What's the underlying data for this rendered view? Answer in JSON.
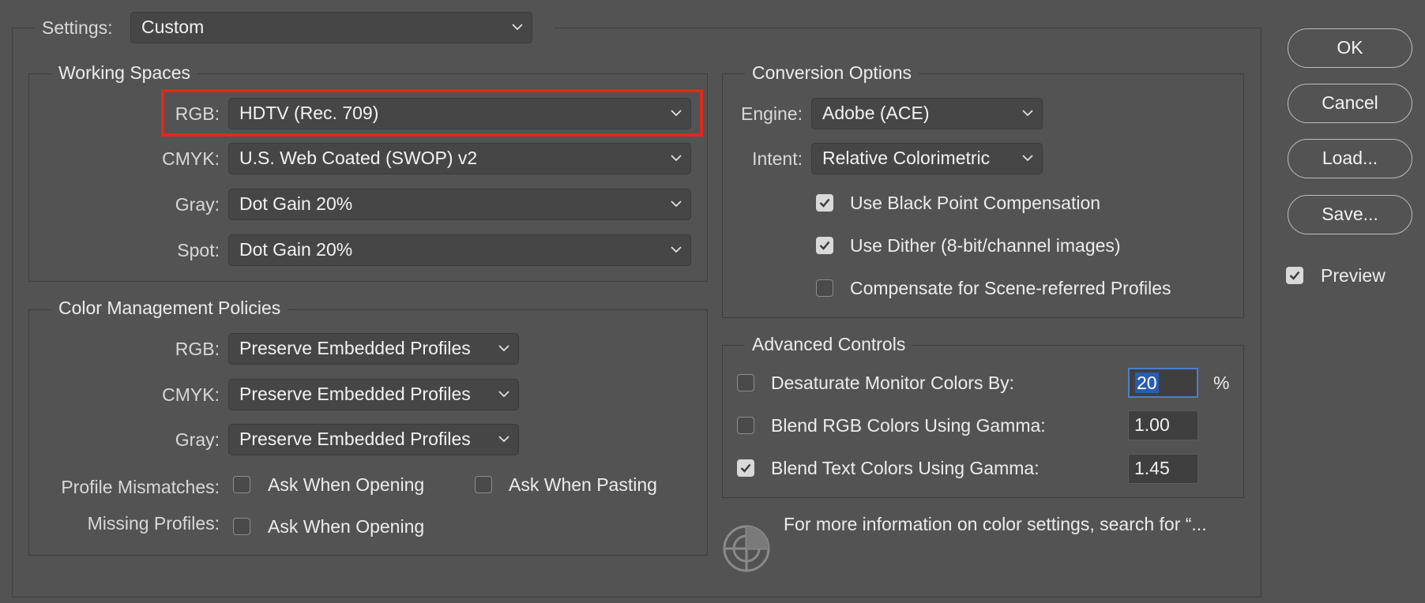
{
  "settings": {
    "label": "Settings:",
    "value": "Custom"
  },
  "working_spaces": {
    "title": "Working Spaces",
    "rgb": {
      "label": "RGB:",
      "value": "HDTV (Rec. 709)"
    },
    "cmyk": {
      "label": "CMYK:",
      "value": "U.S. Web Coated (SWOP) v2"
    },
    "gray": {
      "label": "Gray:",
      "value": "Dot Gain 20%"
    },
    "spot": {
      "label": "Spot:",
      "value": "Dot Gain 20%"
    }
  },
  "policies": {
    "title": "Color Management Policies",
    "rgb": {
      "label": "RGB:",
      "value": "Preserve Embedded Profiles"
    },
    "cmyk": {
      "label": "CMYK:",
      "value": "Preserve Embedded Profiles"
    },
    "gray": {
      "label": "Gray:",
      "value": "Preserve Embedded Profiles"
    },
    "profile_mismatches": {
      "label": "Profile Mismatches:",
      "ask_opening": {
        "label": "Ask When Opening",
        "checked": false
      },
      "ask_pasting": {
        "label": "Ask When Pasting",
        "checked": false
      }
    },
    "missing_profiles": {
      "label": "Missing Profiles:",
      "ask_opening": {
        "label": "Ask When Opening",
        "checked": false
      }
    }
  },
  "conversion": {
    "title": "Conversion Options",
    "engine": {
      "label": "Engine:",
      "value": "Adobe (ACE)"
    },
    "intent": {
      "label": "Intent:",
      "value": "Relative Colorimetric"
    },
    "black_point": {
      "label": "Use Black Point Compensation",
      "checked": true
    },
    "dither": {
      "label": "Use Dither (8-bit/channel images)",
      "checked": true
    },
    "scene_referred": {
      "label": "Compensate for Scene-referred Profiles",
      "checked": false
    }
  },
  "advanced": {
    "title": "Advanced Controls",
    "desaturate": {
      "label": "Desaturate Monitor Colors By:",
      "checked": false,
      "value": "20",
      "unit": "%"
    },
    "blend_rgb": {
      "label": "Blend RGB Colors Using Gamma:",
      "checked": false,
      "value": "1.00"
    },
    "blend_text": {
      "label": "Blend Text Colors Using Gamma:",
      "checked": true,
      "value": "1.45"
    }
  },
  "info_text": "For more information on color settings, search for “...",
  "buttons": {
    "ok": "OK",
    "cancel": "Cancel",
    "load": "Load...",
    "save": "Save..."
  },
  "preview": {
    "label": "Preview",
    "checked": true
  },
  "colors": {
    "background": "#535353",
    "highlight": "#e0291b",
    "selection": "#2a5db0"
  },
  "icons": {
    "dropdown": "chevron-down-icon",
    "check": "checkmark-icon",
    "info": "color-wheel-icon"
  }
}
